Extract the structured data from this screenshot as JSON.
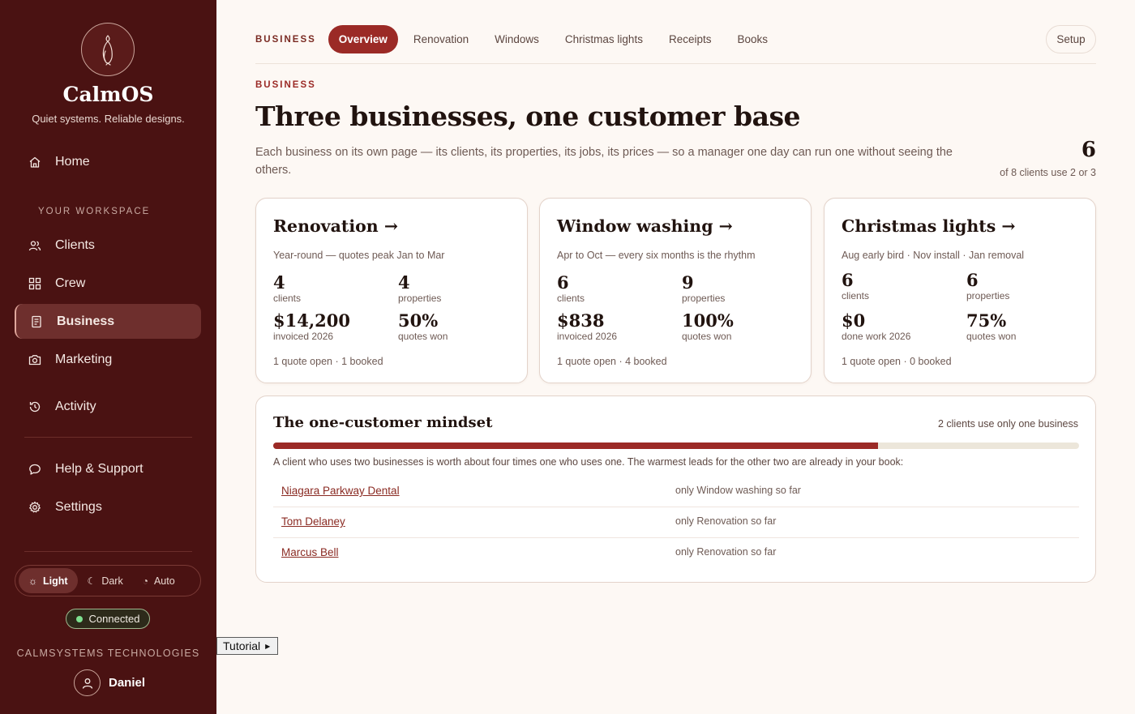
{
  "brand": {
    "name": "CalmOS",
    "tagline": "Quiet systems. Reliable designs."
  },
  "sidebar": {
    "home": "Home",
    "section_label": "YOUR WORKSPACE",
    "items": [
      {
        "label": "Clients",
        "icon": "users-icon"
      },
      {
        "label": "Crew",
        "icon": "grid-icon"
      },
      {
        "label": "Business",
        "icon": "document-icon"
      },
      {
        "label": "Marketing",
        "icon": "camera-icon"
      },
      {
        "label": "Activity",
        "icon": "history-icon"
      }
    ],
    "help": "Help & Support",
    "settings": "Settings",
    "theme": {
      "light": "Light",
      "dark": "Dark",
      "auto": "Auto"
    },
    "connected": "Connected",
    "company": "CALMSYSTEMS TECHNOLOGIES",
    "user": "Daniel"
  },
  "topnav": {
    "label": "BUSINESS",
    "tabs": [
      "Overview",
      "Renovation",
      "Windows",
      "Christmas lights",
      "Receipts",
      "Books"
    ],
    "setup": "Setup"
  },
  "header": {
    "eyebrow": "BUSINESS",
    "title": "Three businesses, one customer base",
    "description": "Each business on its own page — its clients, its properties, its jobs, its prices — so a manager one day can run one without seeing the others.",
    "count": "6",
    "count_sub": "of 8 clients use 2 or 3"
  },
  "cards": [
    {
      "title": "Renovation →",
      "sub": "Year-round — quotes peak Jan to Mar",
      "clients": "4",
      "clients_label": "clients",
      "properties": "4",
      "properties_label": "properties",
      "money": "$14,200",
      "money_label": "invoiced 2026",
      "won": "50%",
      "won_label": "quotes won",
      "foot": "1 quote open · 1 booked"
    },
    {
      "title": "Window washing →",
      "sub": "Apr to Oct — every six months is the rhythm",
      "clients": "6",
      "clients_label": "clients",
      "properties": "9",
      "properties_label": "properties",
      "money": "$838",
      "money_label": "invoiced 2026",
      "won": "100%",
      "won_label": "quotes won",
      "foot": "1 quote open · 4 booked"
    },
    {
      "title": "Christmas lights →",
      "sub": "Aug early bird · Nov install · Jan removal",
      "clients": "6",
      "clients_label": "clients",
      "properties": "6",
      "properties_label": "properties",
      "money": "$0",
      "money_label": "done work 2026",
      "won": "75%",
      "won_label": "quotes won",
      "foot": "1 quote open · 0 booked"
    }
  ],
  "mindset": {
    "title": "The one-customer mindset",
    "side": "2 clients use only one business",
    "progress": 0.75,
    "description": "A client who uses two businesses is worth about four times one who uses one. The warmest leads for the other two are already in your book:",
    "rows": [
      {
        "name": "Niagara Parkway Dental",
        "note": "only Window washing so far"
      },
      {
        "name": "Tom Delaney",
        "note": "only Renovation so far"
      },
      {
        "name": "Marcus Bell",
        "note": "only Renovation so far"
      }
    ]
  },
  "tutorial": "Tutorial",
  "colors": {
    "sidebar": "#4a1212",
    "accent": "#9b2a26",
    "background": "#fdf8f4",
    "connected_dot": "#7ee08f"
  }
}
